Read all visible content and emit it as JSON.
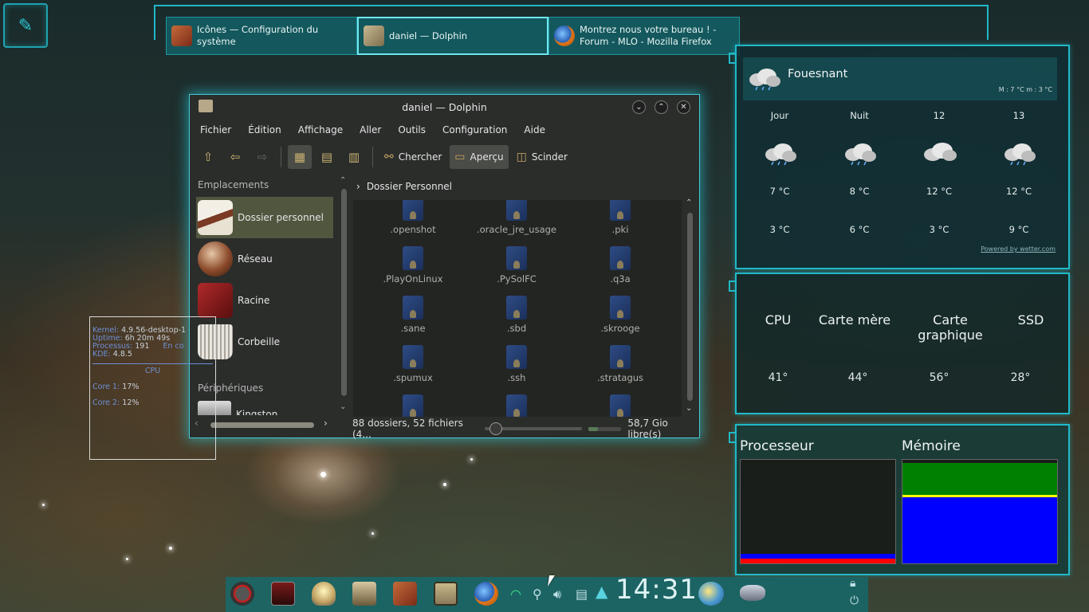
{
  "taskbar": {
    "tasks": [
      {
        "title_line1": "Icônes  — Configuration du",
        "title_line2": "système",
        "icon": "system-settings-icon"
      },
      {
        "title_line1": "daniel — Dolphin",
        "title_line2": "",
        "icon": "dolphin-icon"
      },
      {
        "title_line1": "Montrez nous votre bureau ! -",
        "title_line2": "Forum - MLO - Mozilla Firefox",
        "icon": "firefox-icon"
      }
    ]
  },
  "dolphin": {
    "title": "daniel — Dolphin",
    "menu": [
      "Fichier",
      "Édition",
      "Affichage",
      "Aller",
      "Outils",
      "Configuration",
      "Aide"
    ],
    "toolbar": {
      "search_label": "Chercher",
      "preview_label": "Aperçu",
      "split_label": "Scinder"
    },
    "sidebar": {
      "places_header": "Emplacements",
      "places": [
        "Dossier personnel",
        "Réseau",
        "Racine",
        "Corbeille"
      ],
      "devices_header": "Périphériques",
      "device_partial": "Kingston"
    },
    "breadcrumb": "Dossier Personnel",
    "files": [
      ".openshot",
      ".oracle_jre_usage",
      ".pki",
      ".PlayOnLinux",
      ".PySolFC",
      ".q3a",
      ".sane",
      ".sbd",
      ".skrooge",
      ".spumux",
      ".ssh",
      ".stratagus"
    ],
    "status_text": "88 dossiers, 52 fichiers (4...",
    "free_space": "58,7 Gio libre(s)"
  },
  "sysinfo": {
    "kernel_key": "Kernel:",
    "kernel_val": "4.9.56-desktop-1",
    "uptime_key": "Uptime:",
    "uptime_val": "6h 20m 49s",
    "proc_key": "Processus:",
    "proc_val": "191",
    "proc_extra": "En co",
    "kde_key": "KDE:",
    "kde_val": "4.8.5",
    "cpu_title": "CPU",
    "core1_key": "Core 1:",
    "core1_val": "17%",
    "core2_key": "Core 2:",
    "core2_val": "12%"
  },
  "weather": {
    "city": "Fouesnant",
    "minmax": "M : 7 °C m : 3 °C",
    "columns": [
      {
        "day": "Jour",
        "high": "7 °C",
        "low": "3 °C"
      },
      {
        "day": "Nuit",
        "high": "8 °C",
        "low": "6 °C"
      },
      {
        "day": "12",
        "high": "12 °C",
        "low": "3 °C"
      },
      {
        "day": "13",
        "high": "12 °C",
        "low": "9 °C"
      }
    ],
    "powered": "Powered by wetter.com"
  },
  "temps": {
    "labels": [
      "CPU",
      "Carte mère",
      "Carte graphique",
      "SSD"
    ],
    "values": [
      "41°",
      "44°",
      "56°",
      "28°"
    ]
  },
  "sysmon": {
    "cpu_title": "Processeur",
    "mem_title": "Mémoire",
    "cpu_usage_fraction": 0.09,
    "mem_used_fraction": 0.78,
    "colors": {
      "blue": "#0000ff",
      "red": "#ff0000",
      "green": "#008000",
      "yellow": "#ffff00"
    }
  },
  "panel": {
    "clock": "14:31"
  },
  "colors": {
    "accent": "#20b9c8",
    "panel": "#126e73"
  }
}
